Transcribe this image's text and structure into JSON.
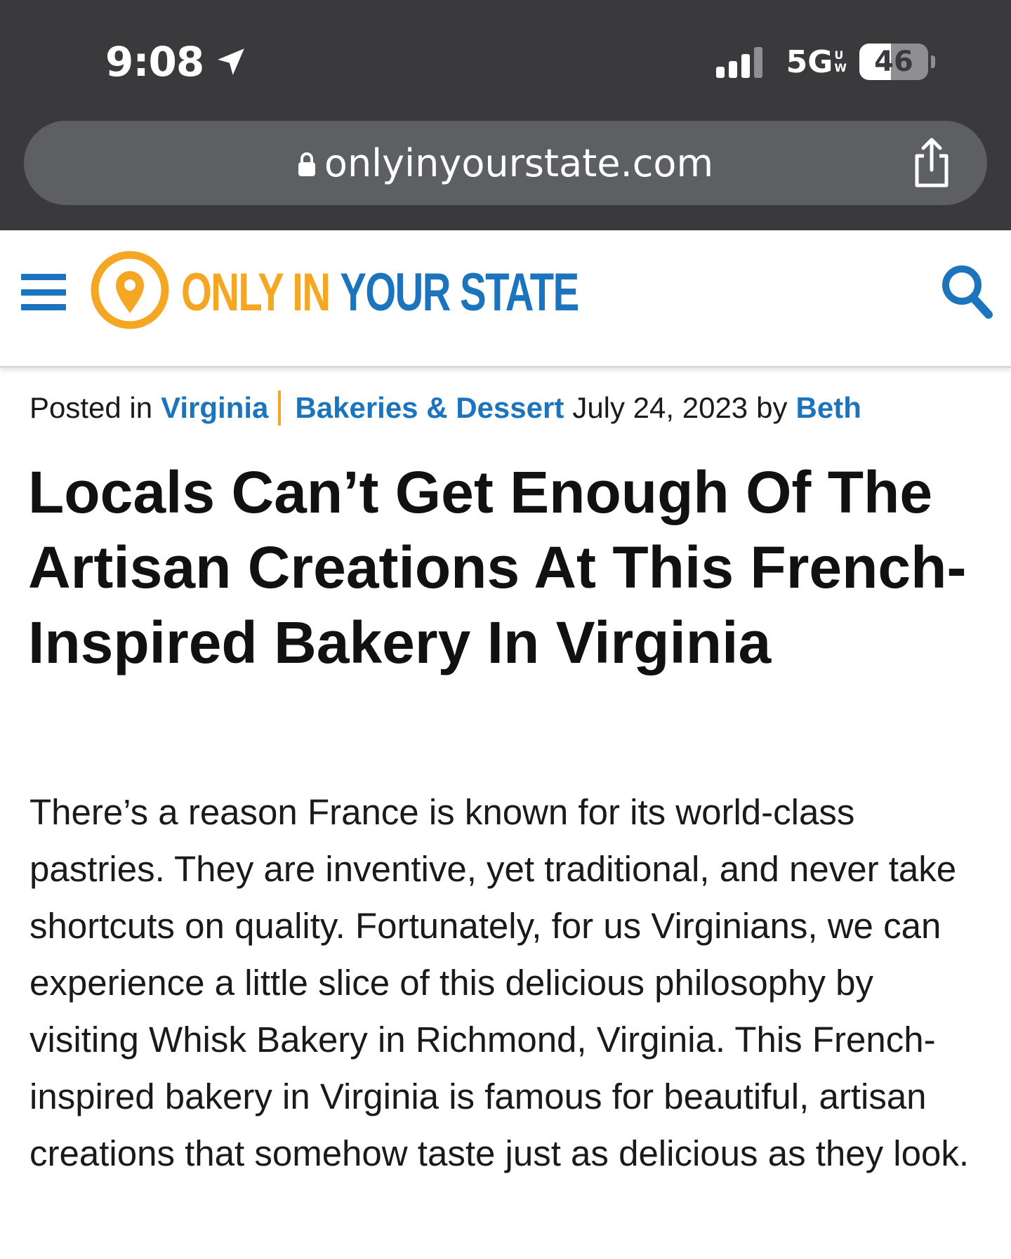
{
  "status_bar": {
    "time": "9:08",
    "network": "5G",
    "network_sub_top": "U",
    "network_sub_bottom": "W",
    "battery": "46",
    "battery_level": 0.46,
    "signal_bars_filled": 3,
    "signal_bars_total": 4
  },
  "browser": {
    "url": "onlyinyourstate.com"
  },
  "site": {
    "logo_part1": "ONLY IN",
    "logo_part2": "YOUR STATE",
    "accent_orange": "#f5a623",
    "accent_blue": "#1c75bc"
  },
  "article": {
    "posted_in_label": "Posted in",
    "category_1": "Virginia",
    "category_2": "Bakeries & Dessert",
    "date": "July 24, 2023",
    "by_label": "by",
    "author": "Beth",
    "title": "Locals Can’t Get Enough Of The Artisan Creations At This French-Inspired Bakery In Virginia",
    "body": "There’s a reason France is known for its world-class pastries. They are inventive, yet traditional, and never take shortcuts on quality. Fortunately, for us Virginians, we can experience a little slice of this delicious philosophy by visiting Whisk Bakery in Richmond, Virginia. This French-inspired bakery in Virginia is famous for beautiful, artisan creations that somehow taste just as delicious as they look."
  },
  "icons": {
    "location": "location-arrow-icon",
    "signal": "signal-bars-icon",
    "battery": "battery-icon",
    "lock": "lock-icon",
    "share": "share-icon",
    "menu": "hamburger-menu-icon",
    "logo": "map-pin-icon",
    "search": "search-icon"
  }
}
